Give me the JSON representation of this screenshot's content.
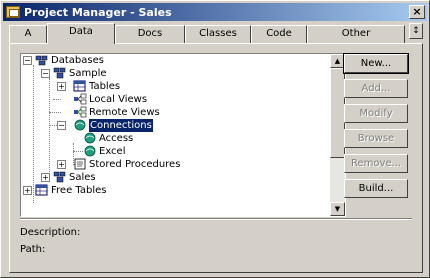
{
  "window": {
    "title": "Project Manager - Sales"
  },
  "tabs": [
    "A",
    "Data",
    "Docs",
    "Classes",
    "Code",
    "Other"
  ],
  "tab_scroll_glyph": "↕",
  "tree": {
    "databases": "Databases",
    "sample": "Sample",
    "tables": "Tables",
    "local_views": "Local Views",
    "remote_views": "Remote Views",
    "connections": "Connections",
    "access": "Access",
    "excel": "Excel",
    "stored_procedures": "Stored Procedures",
    "sales": "Sales",
    "free_tables": "Free Tables"
  },
  "buttons": {
    "new": "New...",
    "add": "Add...",
    "modify": "Modify",
    "browse": "Browse",
    "remove": "Remove...",
    "build": "Build..."
  },
  "info": {
    "description_label": "Description:",
    "path_label": "Path:"
  },
  "colors": {
    "title_start": "#0a246a",
    "title_end": "#a6caf0",
    "selection": "#0a246a",
    "face": "#d4d0c8"
  }
}
